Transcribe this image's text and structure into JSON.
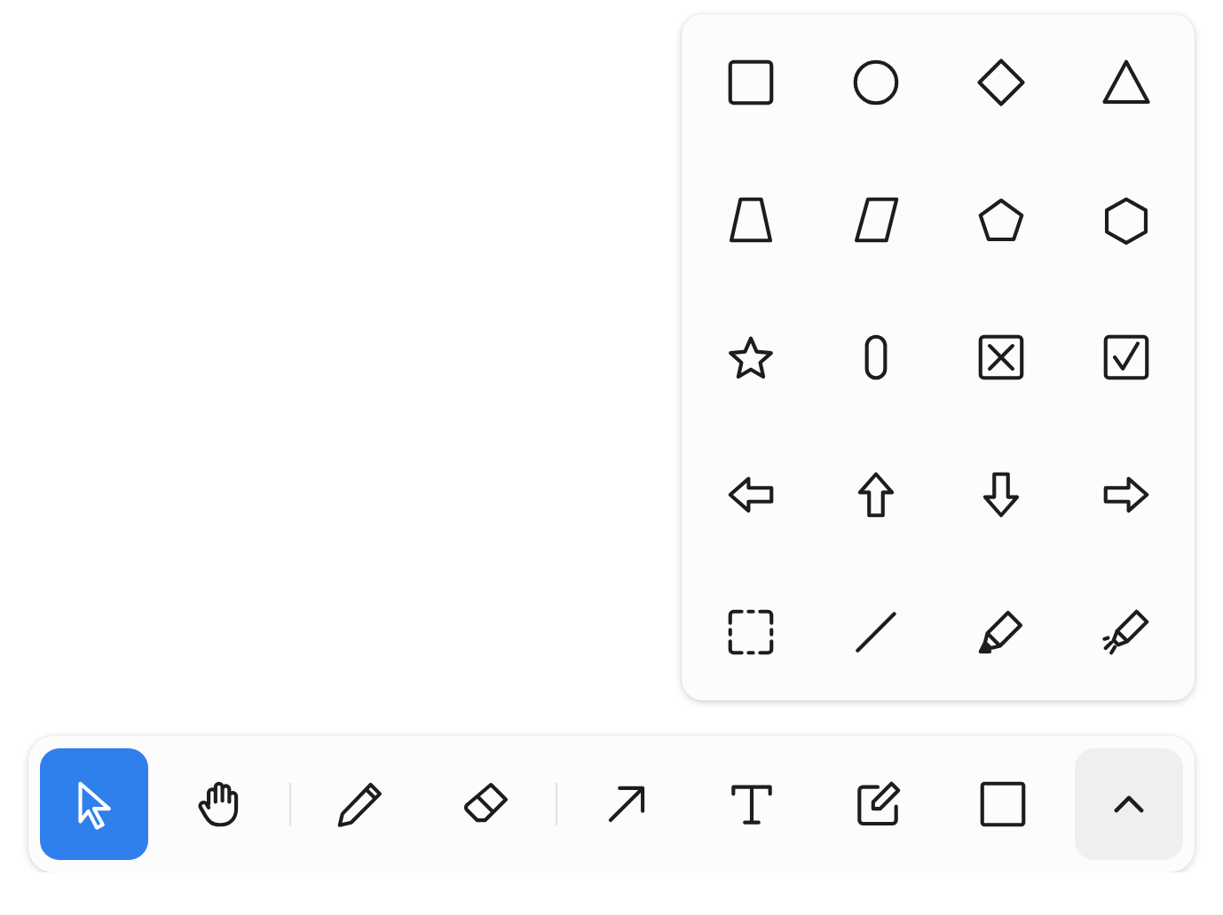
{
  "shapes_panel": {
    "shapes": [
      {
        "kind": "rectangle"
      },
      {
        "kind": "ellipse"
      },
      {
        "kind": "diamond"
      },
      {
        "kind": "triangle"
      },
      {
        "kind": "trapezoid"
      },
      {
        "kind": "parallelogram"
      },
      {
        "kind": "pentagon"
      },
      {
        "kind": "hexagon"
      },
      {
        "kind": "star"
      },
      {
        "kind": "oval"
      },
      {
        "kind": "x-box"
      },
      {
        "kind": "check-box"
      },
      {
        "kind": "arrow-left"
      },
      {
        "kind": "arrow-up"
      },
      {
        "kind": "arrow-down"
      },
      {
        "kind": "arrow-right"
      },
      {
        "kind": "frame"
      },
      {
        "kind": "line"
      },
      {
        "kind": "highlighter"
      },
      {
        "kind": "laser"
      }
    ]
  },
  "toolbar": {
    "tools": [
      {
        "kind": "select",
        "selected": true
      },
      {
        "kind": "hand",
        "selected": false
      },
      {
        "kind": "divider"
      },
      {
        "kind": "draw",
        "selected": false
      },
      {
        "kind": "eraser",
        "selected": false
      },
      {
        "kind": "divider"
      },
      {
        "kind": "arrow",
        "selected": false
      },
      {
        "kind": "text",
        "selected": false
      },
      {
        "kind": "note",
        "selected": false
      },
      {
        "kind": "rectangle",
        "selected": false
      }
    ],
    "more_button": {
      "expanded": true
    }
  }
}
